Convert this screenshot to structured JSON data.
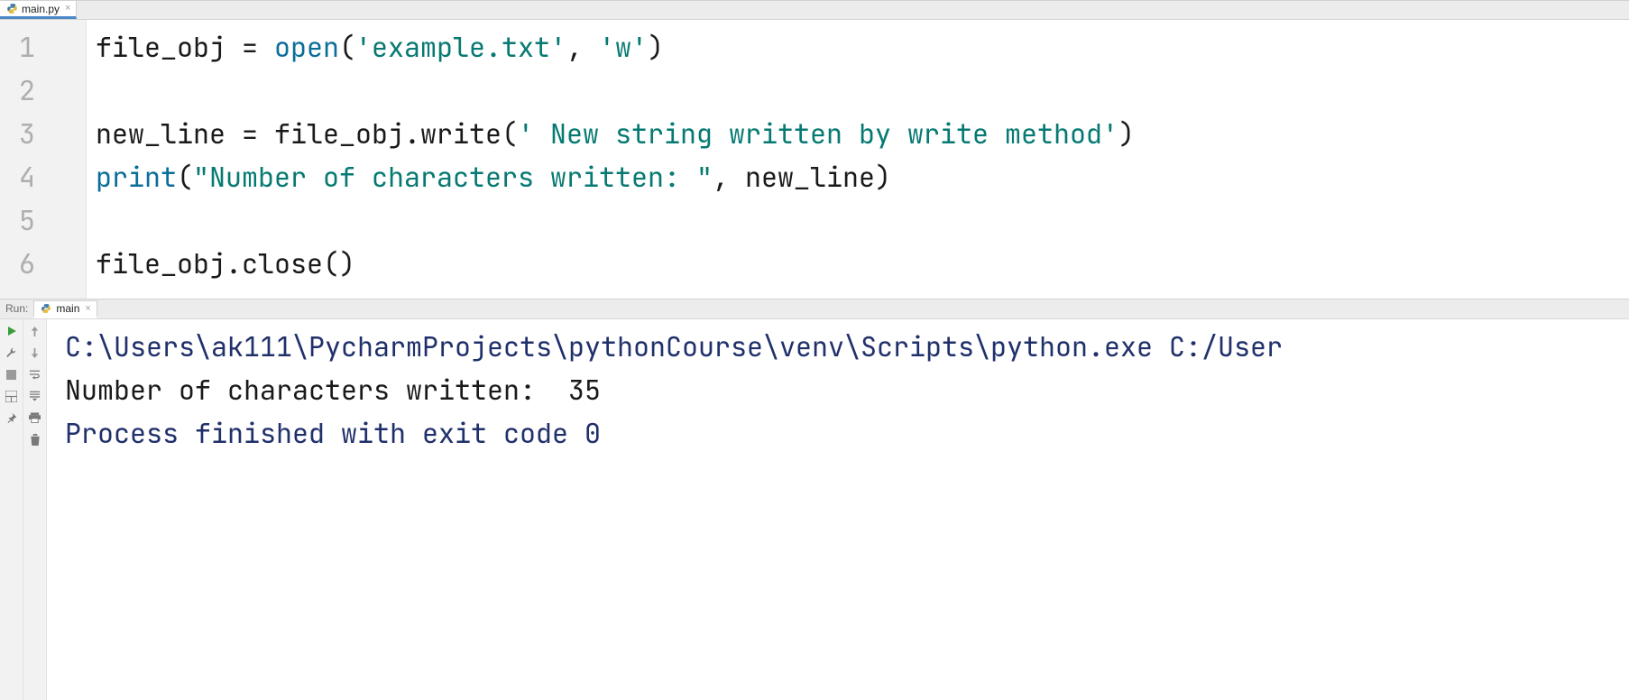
{
  "editor": {
    "tab_label": "main.py",
    "lines": [
      {
        "n": "1"
      },
      {
        "n": "2"
      },
      {
        "n": "3"
      },
      {
        "n": "4"
      },
      {
        "n": "5"
      },
      {
        "n": "6"
      }
    ],
    "code": {
      "l1_a": "file_obj ",
      "l1_eq": "=",
      "l1_sp": " ",
      "l1_open": "open",
      "l1_p1": "(",
      "l1_s1": "'example.txt'",
      "l1_comma": ", ",
      "l1_s2": "'w'",
      "l1_p2": ")",
      "l3_a": "new_line ",
      "l3_eq": "=",
      "l3_sp": " ",
      "l3_obj": "file_obj",
      "l3_dot": ".",
      "l3_write": "write",
      "l3_p1": "(",
      "l3_s1": "' New string written by write method'",
      "l3_p2": ")",
      "l4_print": "print",
      "l4_p1": "(",
      "l4_s1": "\"Number of characters written: \"",
      "l4_comma": ", ",
      "l4_var": "new_line",
      "l4_p2": ")",
      "l6_obj": "file_obj",
      "l6_dot": ".",
      "l6_close": "close",
      "l6_p": "()"
    }
  },
  "run": {
    "panel_label": "Run:",
    "tab_label": "main",
    "console": {
      "line1": "C:\\Users\\ak111\\PycharmProjects\\pythonCourse\\venv\\Scripts\\python.exe C:/User",
      "line2": "Number of characters written:  35",
      "line3": "",
      "line4": "Process finished with exit code 0"
    }
  },
  "icons": {
    "close": "×"
  }
}
